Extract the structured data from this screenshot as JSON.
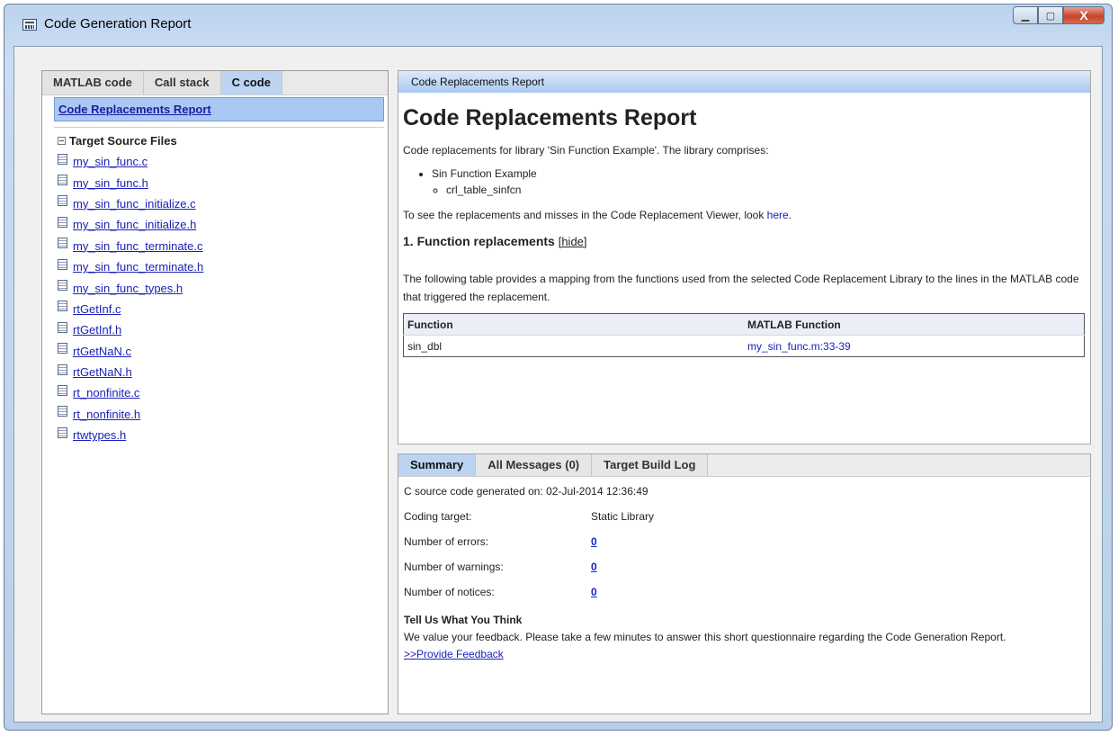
{
  "window": {
    "title": "Code Generation Report",
    "min_glyph": "▁",
    "max_glyph": "▢",
    "close_glyph": "X",
    "icon": "report-window-icon"
  },
  "left_panel": {
    "tabs": [
      {
        "label": "MATLAB code",
        "active": false
      },
      {
        "label": "Call stack",
        "active": false
      },
      {
        "label": "C code",
        "active": true
      }
    ],
    "report_link": "Code Replacements Report",
    "tree_title": "Target Source Files",
    "files": [
      "my_sin_func.c",
      "my_sin_func.h",
      "my_sin_func_initialize.c",
      "my_sin_func_initialize.h",
      "my_sin_func_terminate.c",
      "my_sin_func_terminate.h",
      "my_sin_func_types.h",
      "rtGetInf.c",
      "rtGetInf.h",
      "rtGetNaN.c",
      "rtGetNaN.h",
      "rt_nonfinite.c",
      "rt_nonfinite.h",
      "rtwtypes.h"
    ]
  },
  "report": {
    "header": "Code Replacements Report",
    "title": "Code Replacements Report",
    "intro": "Code replacements for library 'Sin Function Example'. The library comprises:",
    "library": "Sin Function Example",
    "table_name": "crl_table_sinfcn",
    "viewer_text": "To see the replacements and misses in the Code Replacement Viewer, look ",
    "viewer_link": "here",
    "viewer_end": ".",
    "section_title": "1. Function replacements",
    "hide_link": "[hide]",
    "description": "The following table provides a mapping from the functions used from the selected Code Replacement Library to the lines in the MATLAB code that triggered the replacement.",
    "table": {
      "headers": [
        "Function",
        "MATLAB Function"
      ],
      "rows": [
        {
          "function": "sin_dbl",
          "matlab_function": "my_sin_func.m:33-39"
        }
      ]
    }
  },
  "summary": {
    "tabs": [
      {
        "label": "Summary",
        "active": true
      },
      {
        "label": "All Messages (0)",
        "active": false
      },
      {
        "label": "Target Build Log",
        "active": false
      }
    ],
    "generated_label": "C source code generated on:",
    "generated_value": "02-Jul-2014 12:36:49",
    "coding_target_label": "Coding target:",
    "coding_target_value": "Static Library",
    "errors_label": "Number of errors:",
    "errors_value": "0",
    "warnings_label": "Number of warnings:",
    "warnings_value": "0",
    "notices_label": "Number of notices:",
    "notices_value": "0",
    "feedback_title": "Tell Us What You Think",
    "feedback_text": "We value your feedback. Please take a few minutes to answer this short questionnaire regarding the Code Generation Report.",
    "feedback_link": ">>Provide Feedback"
  }
}
